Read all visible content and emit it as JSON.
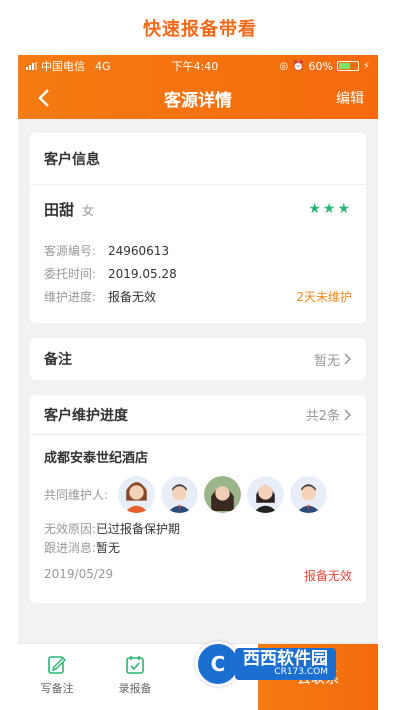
{
  "promo_title": "快速报备带看",
  "status_bar": {
    "carrier": "中国电信",
    "network": "4G",
    "time": "下午4:40",
    "battery": "60%",
    "battery_level": 0.6
  },
  "navbar": {
    "title": "客源详情",
    "edit_label": "编辑"
  },
  "customer_info": {
    "section_title": "客户信息",
    "name": "田甜",
    "gender": "女",
    "rating_stars": 3,
    "fields": [
      {
        "label": "客源编号:",
        "value": "24960613"
      },
      {
        "label": "委托时间:",
        "value": "2019.05.28"
      },
      {
        "label": "维护进度:",
        "value": "报备无效",
        "extra": "2天未维护"
      }
    ]
  },
  "note": {
    "label": "备注",
    "value": "暂无"
  },
  "progress": {
    "section_title": "客户维护进度",
    "count_label": "共2条",
    "hotel": "成都安泰世纪酒店",
    "co_maintainers_label": "共同维护人:",
    "reason_label": "无效原因:",
    "reason_value": "已过报备保护期",
    "follow_label": "跟进消息:",
    "follow_value": "暂无",
    "date": "2019/05/29",
    "status": "报备无效"
  },
  "tabbar": {
    "tabs": [
      {
        "label": "写备注",
        "icon": "edit-note-icon"
      },
      {
        "label": "录报备",
        "icon": "calendar-check-icon"
      }
    ],
    "contact_label": "去联系"
  },
  "watermark": {
    "big": "西西软件园",
    "small": "CR173.COM"
  },
  "colors": {
    "accent": "#f57b12",
    "stars": "#2bb673",
    "warning": "#f2891d",
    "invalid": "#e64a3c"
  }
}
